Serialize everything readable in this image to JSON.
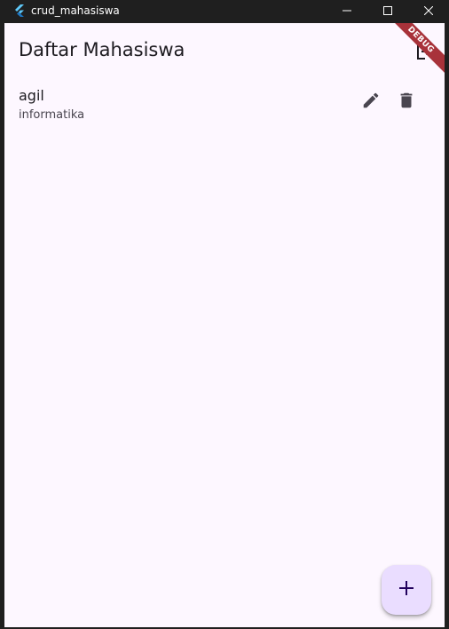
{
  "window": {
    "title": "crud_mahasiswa",
    "icon": "flutter-logo-icon",
    "controls": [
      "minimize-icon",
      "maximize-icon",
      "close-icon"
    ]
  },
  "appbar": {
    "title": "Daftar Mahasiswa",
    "action_icon": "logout-icon"
  },
  "debug_banner": "DEBUG",
  "students": [
    {
      "name": "agil",
      "major": "informatika",
      "actions": [
        "edit-icon",
        "delete-icon"
      ]
    }
  ],
  "fab": {
    "icon": "add-icon"
  },
  "colors": {
    "background": "#fdf7ff",
    "titlebar": "#1f1f1f",
    "fab": "#eaddff",
    "debug_banner": "#a8323a",
    "text_primary": "#1d1b20",
    "text_secondary": "#49454f"
  }
}
